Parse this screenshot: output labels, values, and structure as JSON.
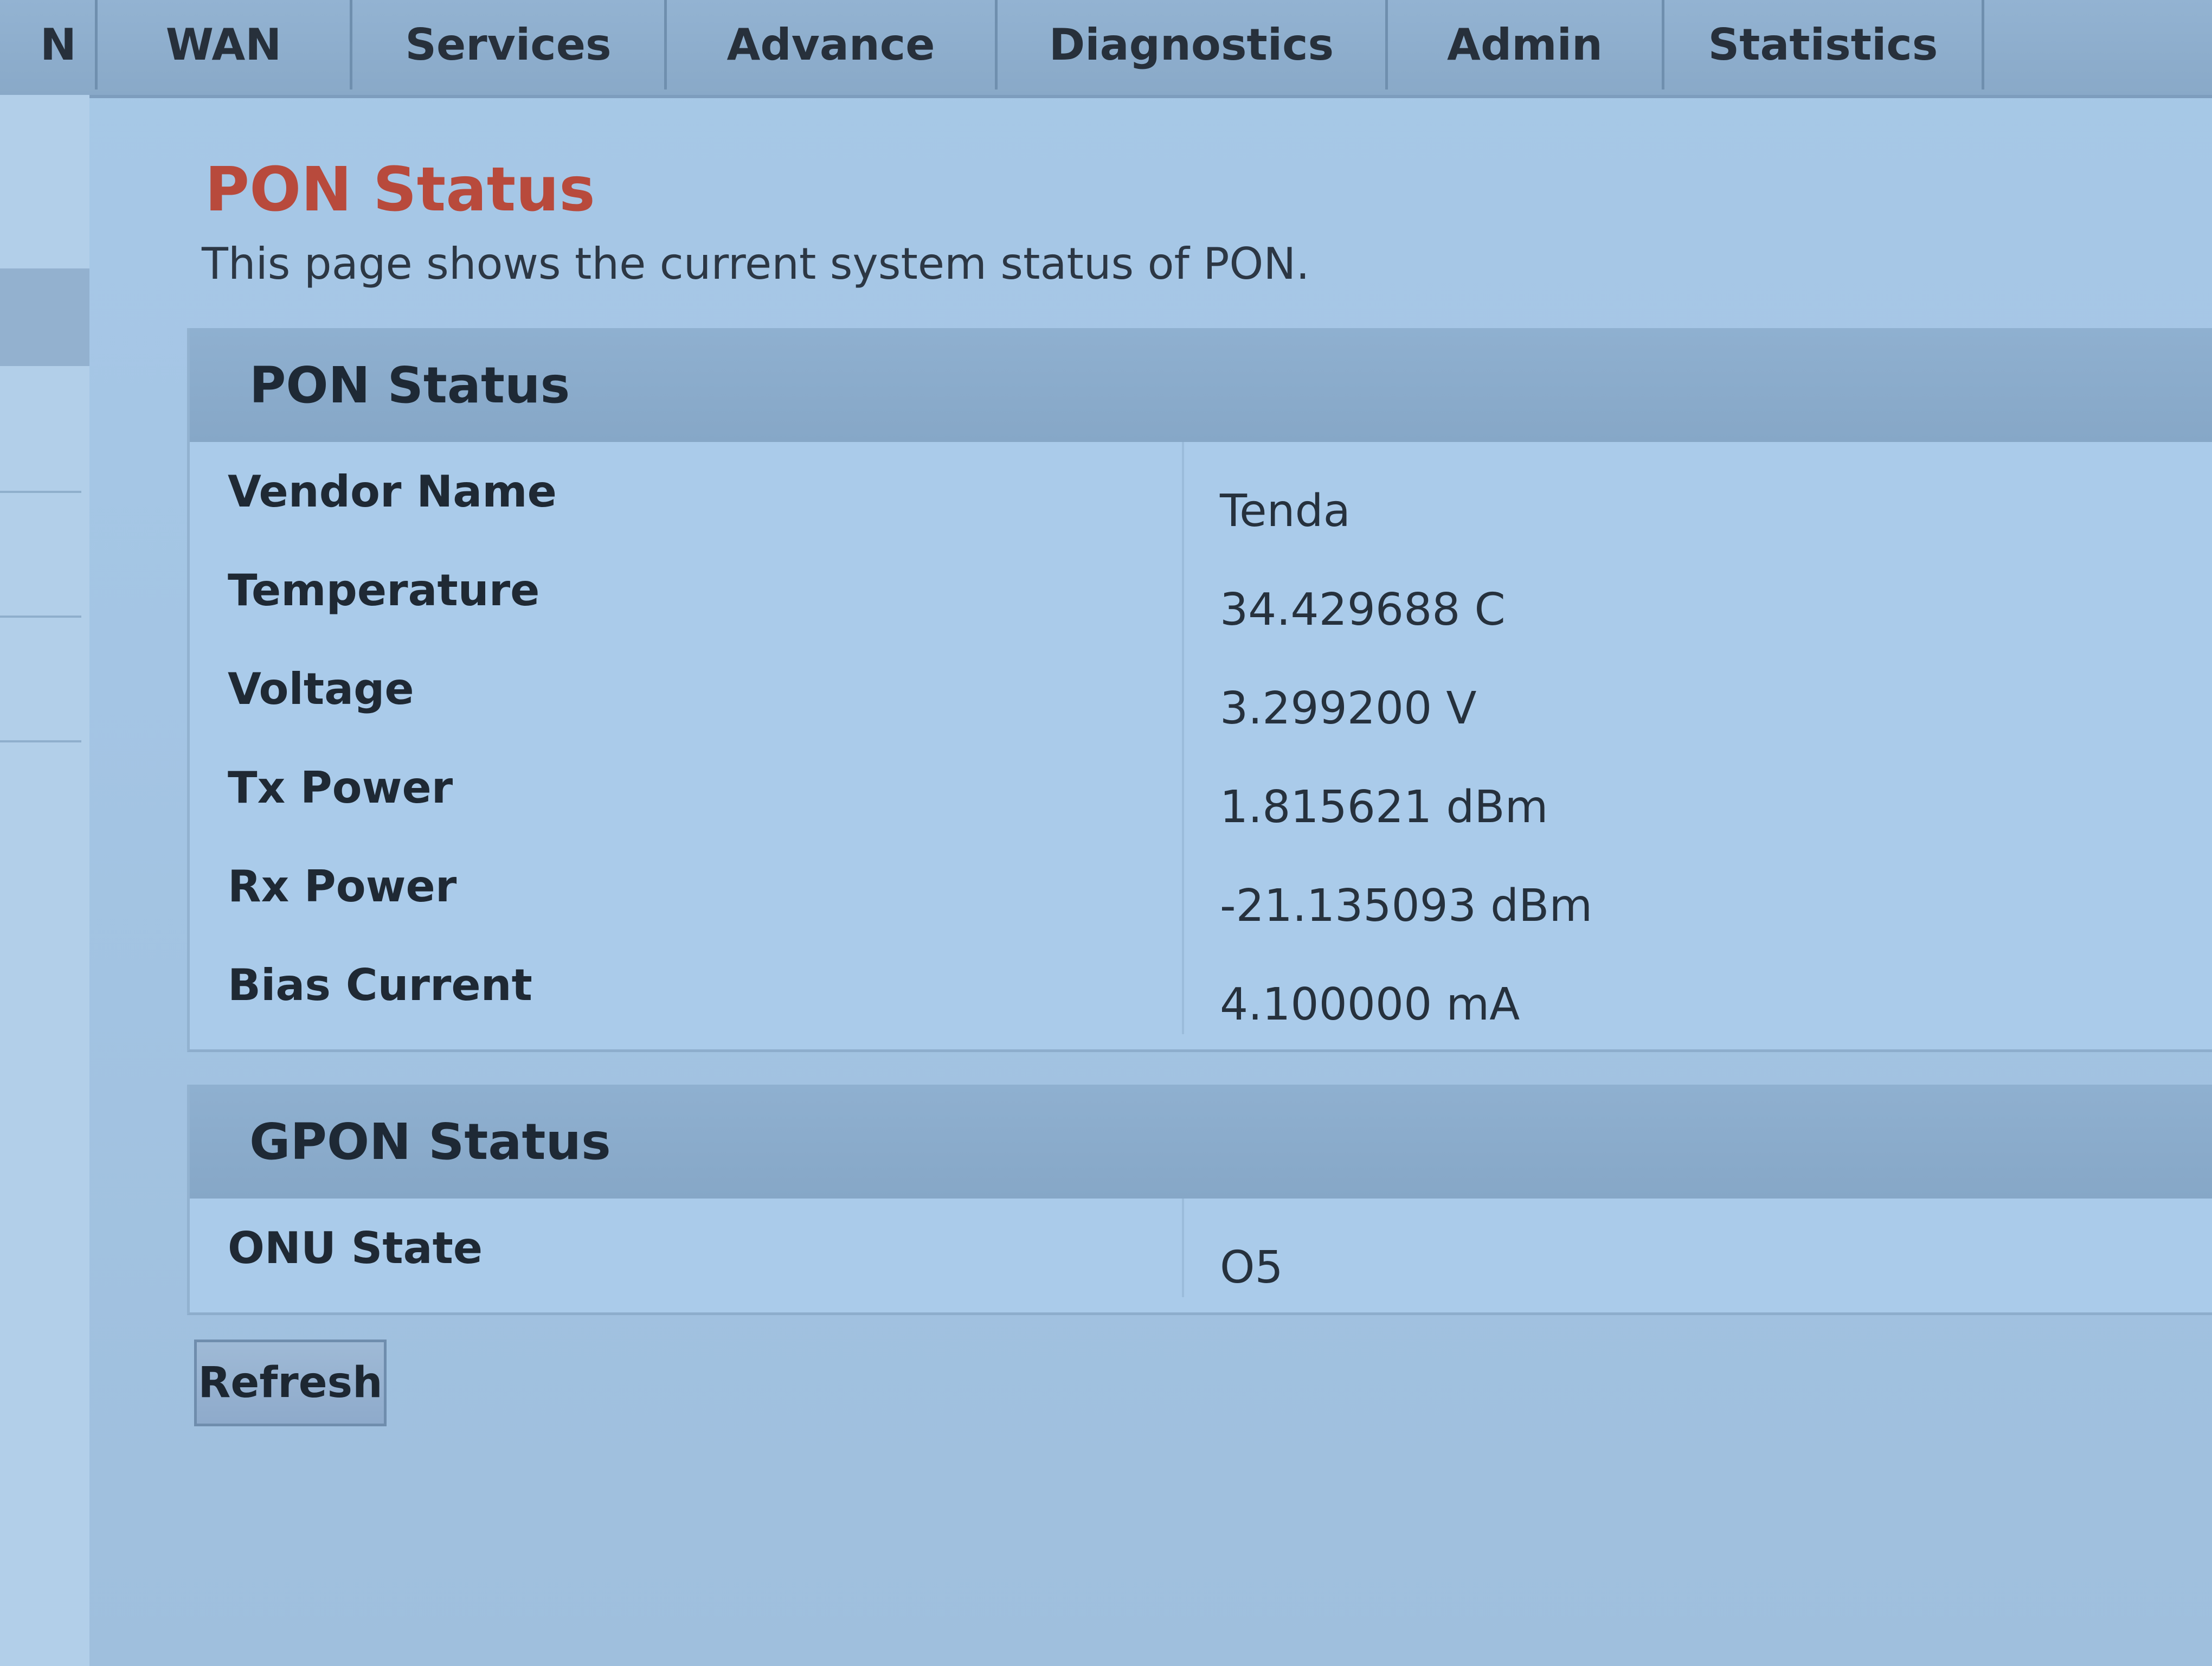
{
  "nav": {
    "tabs": [
      {
        "label": "N"
      },
      {
        "label": "WAN"
      },
      {
        "label": "Services"
      },
      {
        "label": "Advance"
      },
      {
        "label": "Diagnostics"
      },
      {
        "label": "Admin"
      },
      {
        "label": "Statistics"
      }
    ]
  },
  "page": {
    "title": "PON Status",
    "description": "This page shows the current system status of PON."
  },
  "pon_status": {
    "title": "PON Status",
    "rows": [
      {
        "label": "Vendor Name",
        "value": "Tenda"
      },
      {
        "label": "Temperature",
        "value": "34.429688 C"
      },
      {
        "label": "Voltage",
        "value": "3.299200 V"
      },
      {
        "label": "Tx Power",
        "value": "1.815621 dBm"
      },
      {
        "label": "Rx Power",
        "value": "-21.135093 dBm"
      },
      {
        "label": "Bias Current",
        "value": "4.100000 mA"
      }
    ]
  },
  "gpon_status": {
    "title": "GPON Status",
    "rows": [
      {
        "label": "ONU State",
        "value": "O5"
      }
    ]
  },
  "actions": {
    "refresh_label": "Refresh"
  },
  "colors": {
    "page_background": "#a7c8e7",
    "nav_background": "#89a9c8",
    "section_header": "#8fb0d0",
    "title_accent": "#b84a3c"
  }
}
